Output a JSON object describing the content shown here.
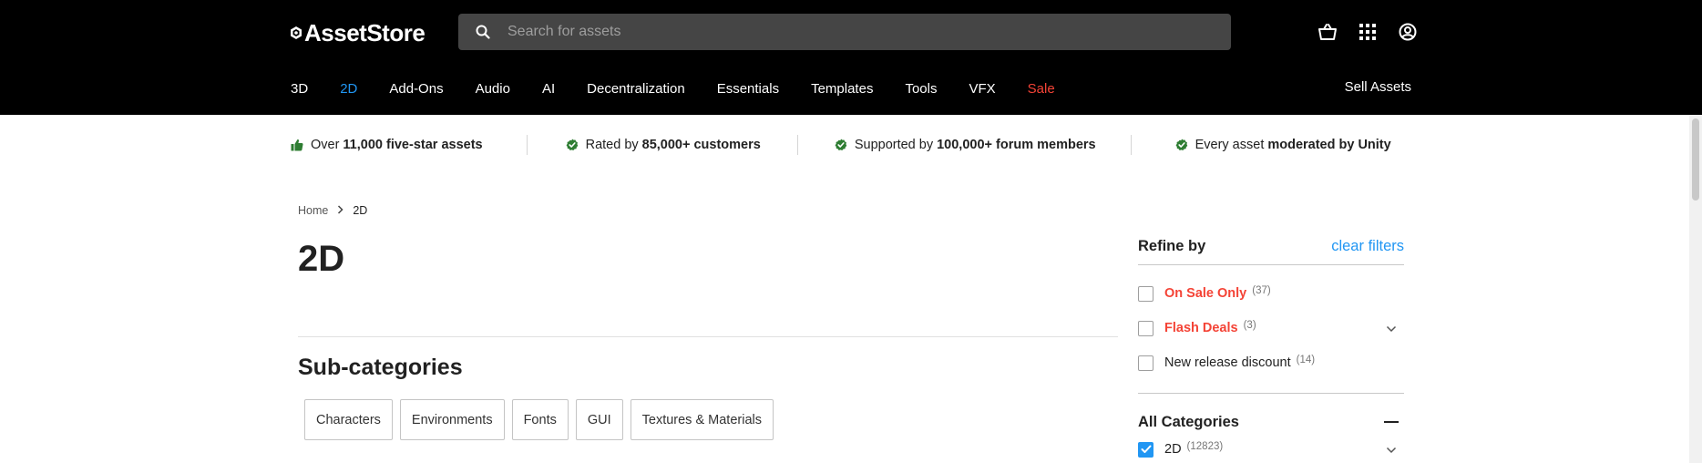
{
  "header": {
    "logo_text": "AssetStore",
    "search_placeholder": "Search for assets",
    "icons": [
      "cart-icon",
      "apps-grid-icon",
      "account-icon"
    ]
  },
  "nav": {
    "items": [
      {
        "label": "3D",
        "state": "normal"
      },
      {
        "label": "2D",
        "state": "active"
      },
      {
        "label": "Add-Ons",
        "state": "normal"
      },
      {
        "label": "Audio",
        "state": "normal"
      },
      {
        "label": "AI",
        "state": "normal"
      },
      {
        "label": "Decentralization",
        "state": "normal"
      },
      {
        "label": "Essentials",
        "state": "normal"
      },
      {
        "label": "Templates",
        "state": "normal"
      },
      {
        "label": "Tools",
        "state": "normal"
      },
      {
        "label": "VFX",
        "state": "normal"
      },
      {
        "label": "Sale",
        "state": "sale"
      }
    ],
    "sell_assets": "Sell Assets"
  },
  "trust_bar": [
    {
      "icon": "thumbs-up-icon",
      "prefix": "Over",
      "bold": "11,000 five-star assets",
      "suffix_bold": ""
    },
    {
      "icon": "check-badge-icon",
      "prefix": "Rated by",
      "bold": "85,000+ customers",
      "suffix_bold": ""
    },
    {
      "icon": "check-badge-icon",
      "prefix": "Supported by",
      "bold": "100,000+ forum members",
      "suffix_bold": ""
    },
    {
      "icon": "check-badge-icon",
      "prefix": "Every asset",
      "bold": "moderated by Unity",
      "suffix_bold": ""
    }
  ],
  "breadcrumb": {
    "home": "Home",
    "current": "2D"
  },
  "page_title": "2D",
  "subcategories": {
    "title": "Sub-categories",
    "items": [
      "Characters",
      "Environments",
      "Fonts",
      "GUI",
      "Textures & Materials"
    ]
  },
  "refine": {
    "title": "Refine by",
    "clear_label": "clear filters",
    "options": [
      {
        "label": "On Sale Only",
        "count": "(37)",
        "checked": false
      },
      {
        "label": "Flash Deals",
        "count": "(3)",
        "checked": false
      },
      {
        "label": "New release discount",
        "count": "(14)",
        "checked": false
      }
    ],
    "all_categories": {
      "title": "All Categories",
      "items": [
        {
          "label": "2D",
          "count": "(12823)",
          "checked": true
        }
      ]
    }
  },
  "colors": {
    "accent": "#2196f3",
    "sale": "#f44336",
    "trust_green": "#2e7d32",
    "header_bg": "#000000"
  }
}
